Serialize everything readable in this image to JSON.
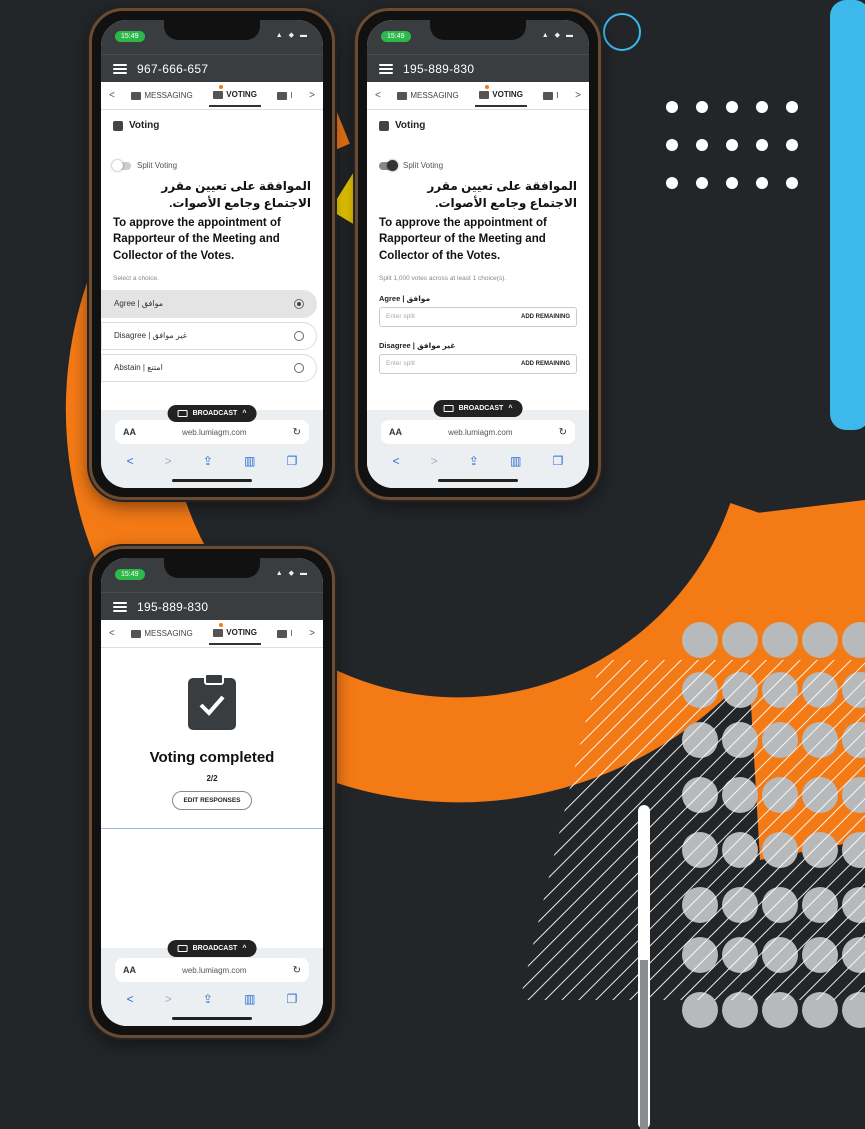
{
  "colors": {
    "background": "#232629",
    "accent_orange": "#f47a16",
    "accent_blue": "#3db8ea",
    "accent_yellow": "#f5d200",
    "dot_gray": "#b7b9bb"
  },
  "phones": [
    {
      "status": {
        "time": "15:49",
        "icons": "▲ ◆ ▬"
      },
      "meeting_id": "967-666-657",
      "tabs": {
        "left_arrow": "<",
        "messaging": "MESSAGING",
        "voting": "VOTING",
        "third": "I",
        "right_arrow": ">"
      },
      "section_title": "Voting",
      "split_voting_label": "Split Voting",
      "question_ar": "الموافقة على تعيين مقرر الاجتماع وجامع الأصوات.",
      "question_en": "To approve the appointment of Rapporteur of the Meeting and Collector of the Votes.",
      "hint": "Select a choice.",
      "choices": [
        {
          "label": "Agree | موافق",
          "selected": true
        },
        {
          "label": "Disagree | غير موافق",
          "selected": false
        },
        {
          "label": "Abstain | امتنع",
          "selected": false
        }
      ],
      "broadcast": "BROADCAST",
      "browser": {
        "aa": "AA",
        "url": "web.lumiagm.com",
        "reload": "↻"
      },
      "nav": {
        "back": "<",
        "forward": ">",
        "share": "⇪",
        "bookmarks": "▥",
        "tabs": "❐"
      }
    },
    {
      "status": {
        "time": "15:49",
        "icons": "▲ ◆ ▬"
      },
      "meeting_id": "195-889-830",
      "tabs": {
        "left_arrow": "<",
        "messaging": "MESSAGING",
        "voting": "VOTING",
        "third": "I",
        "right_arrow": ">"
      },
      "section_title": "Voting",
      "split_voting_label": "Split Voting",
      "question_ar": "الموافقة على تعيين مقرر الاجتماع وجامع الأصوات.",
      "question_en": "To approve the appointment of Rapporteur of the Meeting and Collector of the Votes.",
      "hint": "Split 1,000 votes across at least 1 choice(s).",
      "split_choices": [
        {
          "label": "Agree | موافق",
          "placeholder": "Enter split",
          "button": "ADD REMAINING"
        },
        {
          "label": "Disagree | غير موافق",
          "placeholder": "Enter split",
          "button": "ADD REMAINING"
        }
      ],
      "broadcast": "BROADCAST",
      "browser": {
        "aa": "AA",
        "url": "web.lumiagm.com",
        "reload": "↻"
      },
      "nav": {
        "back": "<",
        "forward": ">",
        "share": "⇪",
        "bookmarks": "▥",
        "tabs": "❐"
      }
    },
    {
      "status": {
        "time": "15:49",
        "icons": "▲ ◆ ▬"
      },
      "meeting_id": "195-889-830",
      "tabs": {
        "left_arrow": "<",
        "messaging": "MESSAGING",
        "voting": "VOTING",
        "third": "I",
        "right_arrow": ">"
      },
      "completed_title": "Voting completed",
      "completed_count": "2/2",
      "edit_button": "EDIT RESPONSES",
      "broadcast": "BROADCAST",
      "browser": {
        "aa": "AA",
        "url": "web.lumiagm.com",
        "reload": "↻"
      },
      "nav": {
        "back": "<",
        "forward": ">",
        "share": "⇪",
        "bookmarks": "▥",
        "tabs": "❐"
      }
    }
  ]
}
